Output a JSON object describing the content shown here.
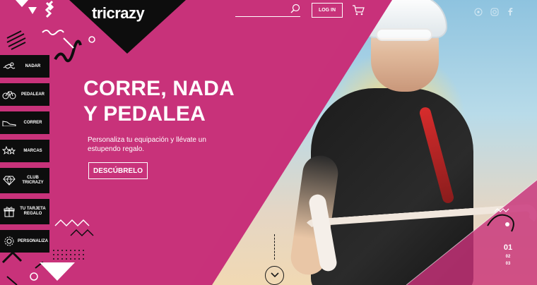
{
  "brand": {
    "name": "tricrazy"
  },
  "header": {
    "search_placeholder": "",
    "login_label": "LOG IN"
  },
  "sidebar": {
    "items": [
      {
        "label": "NADAR",
        "icon": "swim-icon"
      },
      {
        "label": "PEDALEAR",
        "icon": "bike-icon"
      },
      {
        "label": "CORRER",
        "icon": "shoe-icon"
      },
      {
        "label": "MARCAS",
        "icon": "stars-icon"
      },
      {
        "label": "CLUB TRICRAZY",
        "icon": "diamond-icon"
      },
      {
        "label": "TU TARJETA REGALO",
        "icon": "gift-icon"
      },
      {
        "label": "PERSONALIZA",
        "icon": "gear-icon"
      }
    ]
  },
  "hero": {
    "headline_line1": "CORRE, NADA",
    "headline_line2": "Y PEDALEA",
    "subtext": "Personaliza tu equipación y llévate un estupendo regalo.",
    "cta_label": "DESCÚBRELO"
  },
  "pager": {
    "current": "01",
    "items": [
      "02",
      "03"
    ]
  },
  "colors": {
    "brand_pink": "#c8327a",
    "black": "#0d0d0d",
    "white": "#ffffff"
  }
}
